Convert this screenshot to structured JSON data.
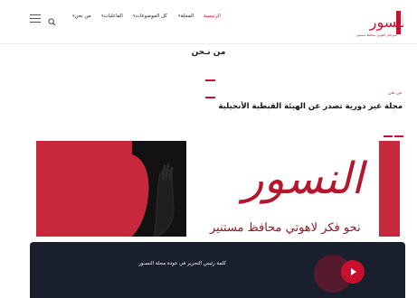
{
  "header": {
    "nav": [
      {
        "label": "الرئيسية",
        "active": true,
        "caret": false
      },
      {
        "label": "المجلة",
        "active": false,
        "caret": true
      },
      {
        "label": "كل الموضوعات",
        "active": false,
        "caret": true
      },
      {
        "label": "الفاعليات",
        "active": false,
        "caret": true
      },
      {
        "label": "من نحن",
        "active": false,
        "caret": true
      }
    ],
    "logo_text": "النسور",
    "logo_tagline": "نحو فكر لاهوتي محافظ مستنير",
    "search_icon": "search-icon",
    "menu_icon": "hamburger-menu-icon"
  },
  "page": {
    "title": "من نـحن",
    "kicker": "من نحن",
    "heading": "مجلة غير دورية تصدر عن الهيئة القبطية الأنجيلية"
  },
  "banner": {
    "logo_text": "النسور",
    "caption": "نحو فكر لاهوتي محافظ مستنير"
  },
  "video": {
    "title": "كلمة رئيس التحرير في عودة مجلة النسـور",
    "play_icon": "play-icon"
  },
  "colors": {
    "accent": "#c8102e",
    "banner_red": "#c8283b",
    "banner_dark": "#121212",
    "video_bg": "#1a1f2e"
  }
}
